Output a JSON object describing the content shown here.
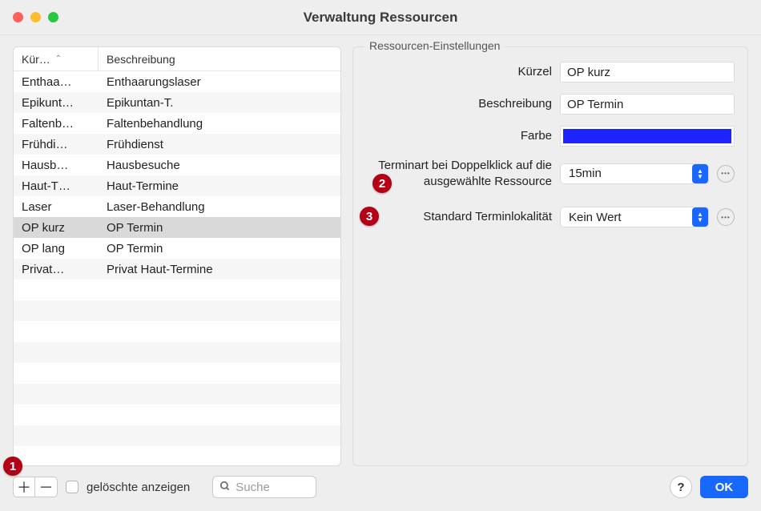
{
  "window": {
    "title": "Verwaltung Ressourcen"
  },
  "table": {
    "head_kurz": "Kür…",
    "head_beschr": "Beschreibung",
    "rows": [
      {
        "k": "Enthaa…",
        "d": "Enthaarungslaser"
      },
      {
        "k": "Epikunt…",
        "d": "Epikuntan-T."
      },
      {
        "k": "Faltenb…",
        "d": "Faltenbehandlung"
      },
      {
        "k": "Frühdi…",
        "d": "Frühdienst"
      },
      {
        "k": "Hausb…",
        "d": "Hausbesuche"
      },
      {
        "k": "Haut-T…",
        "d": "Haut-Termine"
      },
      {
        "k": "Laser",
        "d": "Laser-Behandlung"
      },
      {
        "k": "OP kurz",
        "d": "OP Termin"
      },
      {
        "k": "OP lang",
        "d": "OP Termin"
      },
      {
        "k": "Privat…",
        "d": "Privat Haut-Termine"
      }
    ],
    "selected_index": 7
  },
  "settings": {
    "legend": "Ressourcen-Einstellungen",
    "kuerzel_label": "Kürzel",
    "kuerzel_value": "OP kurz",
    "beschr_label": "Beschreibung",
    "beschr_value": "OP Termin",
    "farbe_label": "Farbe",
    "farbe_value": "#1e24ff",
    "terminart_label": "Terminart bei Doppelklick auf die ausgewählte Ressource",
    "terminart_value": "15min",
    "lokal_label": "Standard Terminlokalität",
    "lokal_value": "Kein Wert"
  },
  "footer": {
    "show_deleted_label": "gelöschte anzeigen",
    "search_placeholder": "Suche",
    "ok_label": "OK"
  },
  "callouts": {
    "c1": "1",
    "c2": "2",
    "c3": "3"
  }
}
